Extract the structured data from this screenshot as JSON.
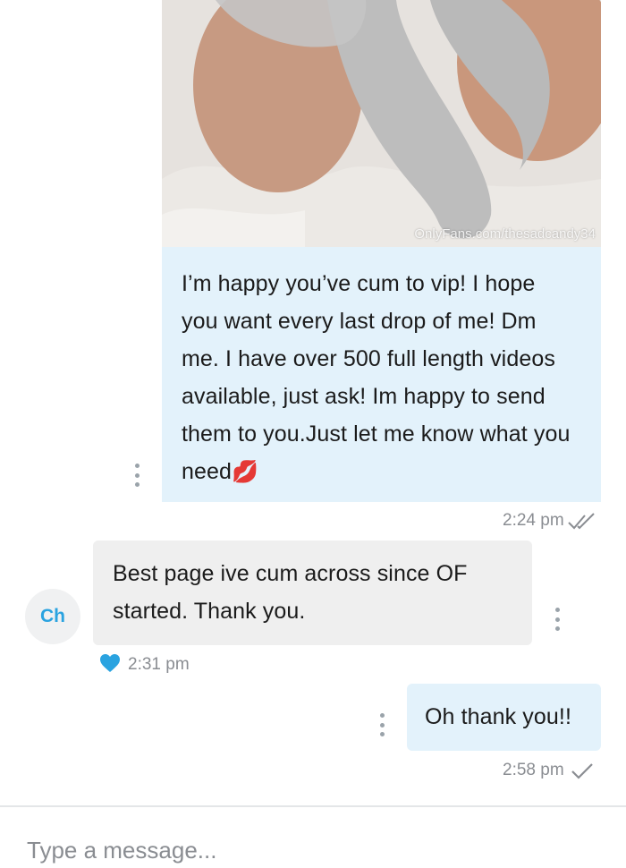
{
  "messages": {
    "m1": {
      "watermark": "OnlyFans.com/thesadcandy34",
      "text": "I’m happy you’ve cum to vip! I hope you want every last drop of me! Dm me. I have over 500 full length videos available, just ask! Im happy to send them to you.Just let me know what you need",
      "emoji": "💋",
      "time": "2:24 pm"
    },
    "m2": {
      "avatar_initials": "Ch",
      "text": "Best page ive cum across since OF started. Thank you.",
      "time": "2:31 pm"
    },
    "m3": {
      "text": "Oh thank you!!",
      "time": "2:58 pm"
    }
  },
  "composer": {
    "placeholder": "Type a message..."
  },
  "colors": {
    "outgoing_bubble": "#e3f2fb",
    "incoming_bubble": "#efefef",
    "accent": "#2aa3e0",
    "meta_text": "#8a8d92"
  },
  "icons": {
    "read_receipt": "double-check-icon",
    "sent_receipt": "check-icon",
    "liked": "heart-icon",
    "options": "more-vertical-icon"
  }
}
